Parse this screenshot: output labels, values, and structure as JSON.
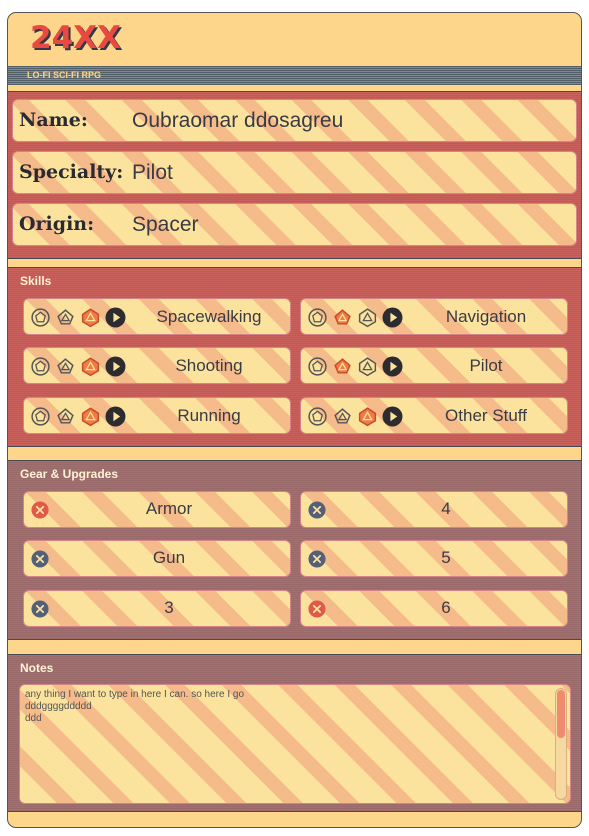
{
  "app": {
    "title": "24XX",
    "subtitle": "LO-FI SCI-FI RPG"
  },
  "identity": [
    {
      "label": "Name:",
      "value": "Oubraomar ddosagreu"
    },
    {
      "label": "Specialty:",
      "value": "Pilot"
    },
    {
      "label": "Origin:",
      "value": "Spacer"
    }
  ],
  "skills": {
    "title": "Skills",
    "items": [
      {
        "name": "Spacewalking",
        "selected_die": 3
      },
      {
        "name": "Navigation",
        "selected_die": 2
      },
      {
        "name": "Shooting",
        "selected_die": 3
      },
      {
        "name": "Pilot",
        "selected_die": 2
      },
      {
        "name": "Running",
        "selected_die": 3
      },
      {
        "name": "Other Stuff",
        "selected_die": 3
      }
    ]
  },
  "gear": {
    "title": "Gear & Upgrades",
    "items": [
      {
        "name": "Armor",
        "status": "active"
      },
      {
        "name": "4",
        "status": "inactive"
      },
      {
        "name": "Gun",
        "status": "inactive"
      },
      {
        "name": "5",
        "status": "inactive"
      },
      {
        "name": "3",
        "status": "inactive"
      },
      {
        "name": "6",
        "status": "active"
      }
    ]
  },
  "notes": {
    "title": "Notes",
    "value": "any thing I want to type in here I can. so here I go\ndddggggddddd\nddd"
  },
  "colors": {
    "accent": "#e84a3f",
    "die_selected": "#ef7b45",
    "x_active": "#e05a4a",
    "x_inactive": "#54607a",
    "play": "#2c2c30"
  }
}
